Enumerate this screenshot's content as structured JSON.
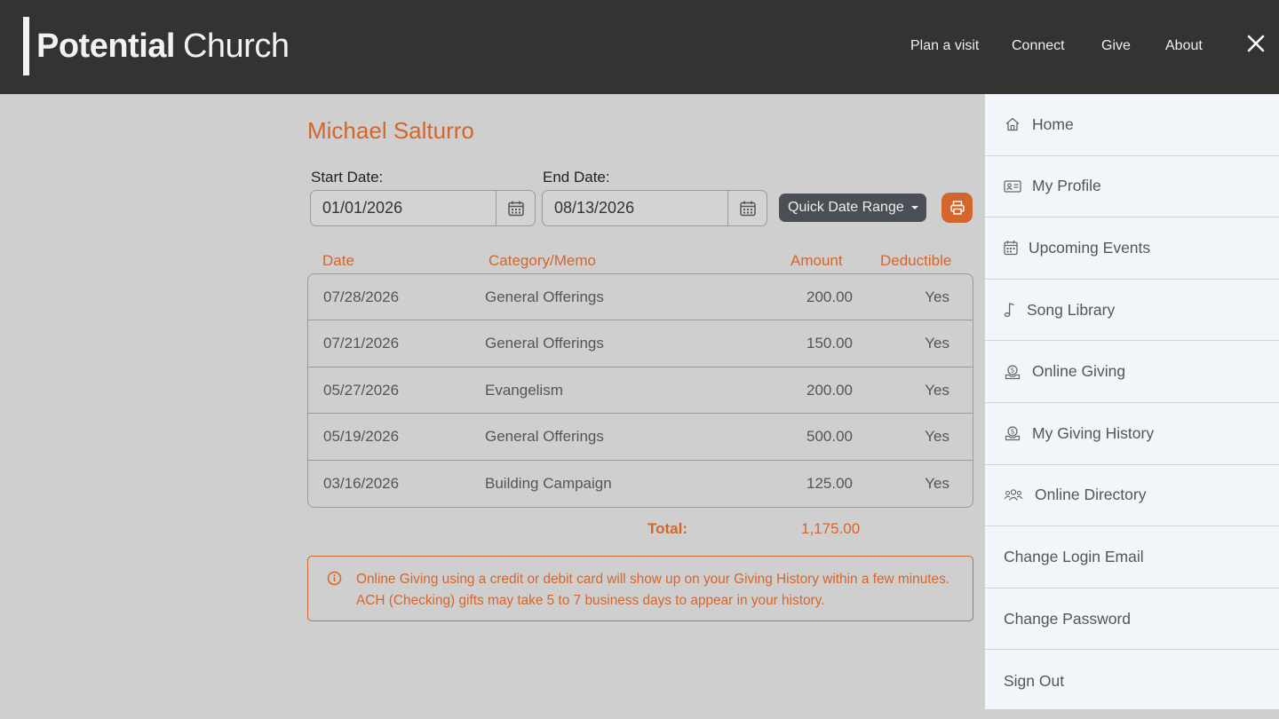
{
  "header": {
    "logo_strong": "Potential",
    "logo_light": "Church",
    "nav": [
      "Plan a visit",
      "Connect",
      "Give",
      "About"
    ],
    "close_icon": "close-icon"
  },
  "main": {
    "user_name": "Michael Salturro",
    "start_date_label": "Start Date:",
    "start_date_value": "01/01/2026",
    "end_date_label": "End Date:",
    "end_date_value": "08/13/2026",
    "quick_range_label": "Quick Date Range",
    "print_icon": "printer-icon",
    "table": {
      "headers": [
        "Date",
        "Category/Memo",
        "Amount",
        "Deductible"
      ],
      "rows": [
        {
          "date": "07/28/2026",
          "category": "General Offerings",
          "amount": "200.00",
          "deductible": "Yes"
        },
        {
          "date": "07/21/2026",
          "category": "General Offerings",
          "amount": "150.00",
          "deductible": "Yes"
        },
        {
          "date": "05/27/2026",
          "category": "Evangelism",
          "amount": "200.00",
          "deductible": "Yes"
        },
        {
          "date": "05/19/2026",
          "category": "General Offerings",
          "amount": "500.00",
          "deductible": "Yes"
        },
        {
          "date": "03/16/2026",
          "category": "Building Campaign",
          "amount": "125.00",
          "deductible": "Yes"
        }
      ]
    },
    "total_label": "Total:",
    "total_value": "1,175.00",
    "notice": "Online Giving using a credit or debit card will show up on your Giving History within a few minutes. ACH (Checking) gifts may take 5 to 7 business days to appear in your history."
  },
  "menu": {
    "items": [
      {
        "label": "Home",
        "icon": "home-icon"
      },
      {
        "label": "My Profile",
        "icon": "id-card-icon"
      },
      {
        "label": "Upcoming Events",
        "icon": "calendar-icon"
      },
      {
        "label": "Song Library",
        "icon": "music-note-icon"
      },
      {
        "label": "Online Giving",
        "icon": "donation-icon"
      },
      {
        "label": "My Giving History",
        "icon": "donation-icon"
      },
      {
        "label": "Online Directory",
        "icon": "people-icon"
      },
      {
        "label": "Change Login Email",
        "icon": ""
      },
      {
        "label": "Change Password",
        "icon": ""
      },
      {
        "label": "Sign Out",
        "icon": ""
      }
    ]
  },
  "colors": {
    "accent": "#d2662d",
    "header_bg": "#333333",
    "page_bg": "#cfcfcf",
    "menu_bg": "#f2f6fa",
    "quick_btn_bg": "#4a4f55"
  }
}
